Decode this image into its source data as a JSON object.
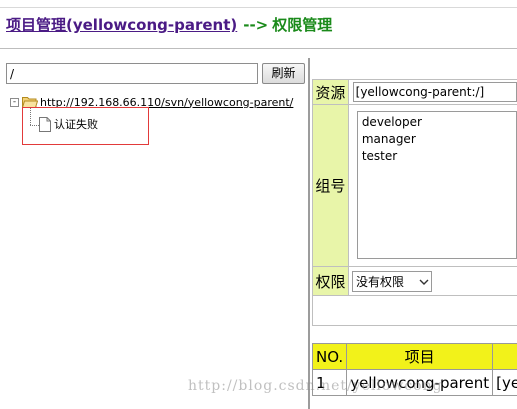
{
  "header": {
    "project_link": "项目管理(yellowcong-parent)",
    "arrow": "-->",
    "section": "权限管理"
  },
  "tree": {
    "path_value": "/",
    "refresh_label": "刷新",
    "expander_symbol": "-",
    "root_label": "http://192.168.66.110/svn/yellowcong-parent/",
    "child_label": "认证失败"
  },
  "form": {
    "resource_label": "资源",
    "resource_value": "[yellowcong-parent:/]",
    "group_label": "组号",
    "groups": [
      "developer",
      "manager",
      "tester"
    ],
    "permission_label": "权限",
    "permission_value": "没有权限"
  },
  "table": {
    "headers": [
      "NO.",
      "项目",
      ""
    ],
    "rows": [
      [
        "1",
        "yellowcong-parent",
        "[ye"
      ]
    ]
  },
  "watermark": "http://blog.csdn.net/yellowcong",
  "colors": {
    "label_bg": "#e8f5a9",
    "table_header_bg": "#f2f21a",
    "highlight_border": "#e23a3a",
    "link": "#4b1b85",
    "heading_green": "#1a8a1a"
  }
}
